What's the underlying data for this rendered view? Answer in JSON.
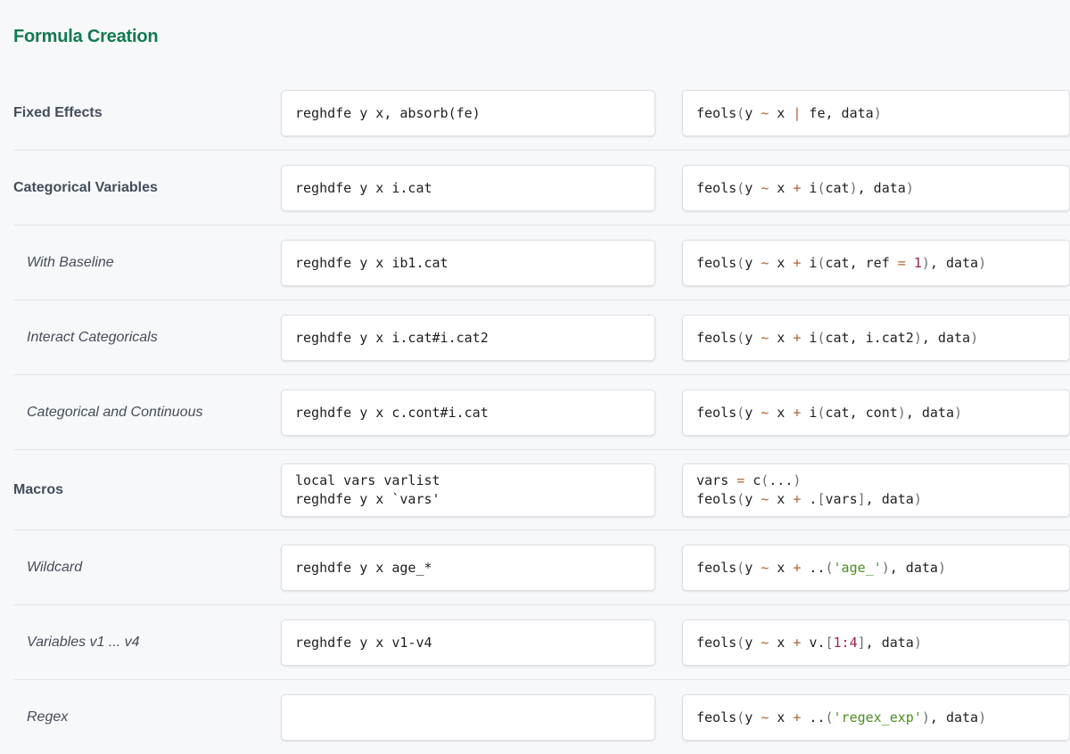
{
  "section": {
    "title": "Formula Creation"
  },
  "rows": [
    {
      "label": "Fixed Effects",
      "level": "main",
      "stata": [
        "reghdfe y x, absorb(fe)"
      ],
      "r": [
        [
          "feols",
          "(",
          "y ",
          "~",
          " x ",
          "|",
          " fe, data",
          ")"
        ]
      ]
    },
    {
      "label": "Categorical Variables",
      "level": "main",
      "stata": [
        "reghdfe y x i.cat"
      ],
      "r": [
        [
          "feols",
          "(",
          "y ",
          "~",
          " x ",
          "+",
          " i",
          "(",
          "cat",
          ")",
          ", data",
          ")"
        ]
      ]
    },
    {
      "label": "With Baseline",
      "level": "sub",
      "stata": [
        "reghdfe y x ib1.cat"
      ],
      "r": [
        [
          "feols",
          "(",
          "y ",
          "~",
          " x ",
          "+",
          " i",
          "(",
          "cat, ref ",
          "=",
          " ",
          "1",
          ")",
          ", data",
          ")"
        ]
      ]
    },
    {
      "label": "Interact Categoricals",
      "level": "sub",
      "stata": [
        "reghdfe y x i.cat#i.cat2"
      ],
      "r": [
        [
          "feols",
          "(",
          "y ",
          "~",
          " x ",
          "+",
          " i",
          "(",
          "cat, i.cat2",
          ")",
          ", data",
          ")"
        ]
      ]
    },
    {
      "label": "Categorical and Continuous",
      "level": "sub",
      "stata": [
        "reghdfe y x c.cont#i.cat"
      ],
      "r": [
        [
          "feols",
          "(",
          "y ",
          "~",
          " x ",
          "+",
          " i",
          "(",
          "cat, cont",
          ")",
          ", data",
          ")"
        ]
      ]
    },
    {
      "label": "Macros",
      "level": "main",
      "stata": [
        "local vars varlist",
        "reghdfe y x `vars'"
      ],
      "r": [
        [
          "vars ",
          "=",
          " c",
          "(",
          "...",
          ")"
        ],
        [
          "feols",
          "(",
          "y ",
          "~",
          " x ",
          "+",
          " .",
          "[",
          "vars",
          "]",
          ", data",
          ")"
        ]
      ]
    },
    {
      "label": "Wildcard",
      "level": "sub",
      "stata": [
        "reghdfe y x age_*"
      ],
      "r": [
        [
          "feols",
          "(",
          "y ",
          "~",
          " x ",
          "+",
          " ..",
          "(",
          "'age_'",
          ")",
          ", data",
          ")"
        ]
      ]
    },
    {
      "label": "Variables v1 ... v4",
      "level": "sub",
      "stata": [
        "reghdfe y x v1-v4"
      ],
      "r": [
        [
          "feols",
          "(",
          "y ",
          "~",
          " x ",
          "+",
          " v.",
          "[",
          "1:4",
          "]",
          ", data",
          ")"
        ]
      ]
    },
    {
      "label": "Regex",
      "level": "sub",
      "stata": [],
      "r": [
        [
          "feols",
          "(",
          "y ",
          "~",
          " x ",
          "+",
          " ..",
          "(",
          "'regex_exp'",
          ")",
          ", data",
          ")"
        ]
      ]
    }
  ],
  "token_colors": {
    "operator": "#b0632e",
    "paren": "#6b6f75",
    "number": "#a1205a",
    "string": "#4a8f1f",
    "title": "#127a4f"
  }
}
